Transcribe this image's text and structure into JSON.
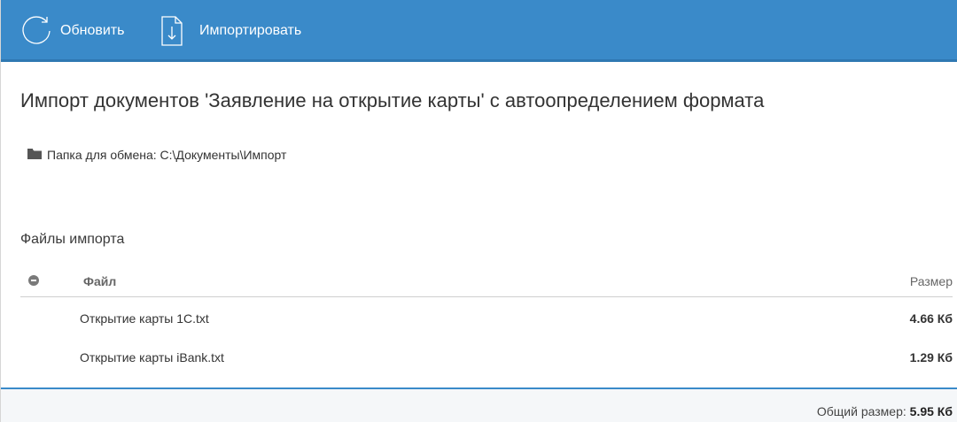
{
  "toolbar": {
    "refresh_label": "Обновить",
    "import_label": "Импортировать",
    "background": "#3a8ac9"
  },
  "page": {
    "title": "Импорт документов 'Заявление на открытие карты' с автоопределением формата",
    "folder_label": "Папка для обмена: C:\\Документы\\Импорт"
  },
  "files": {
    "section_title": "Файлы импорта",
    "columns": {
      "file": "Файл",
      "size": "Размер"
    },
    "rows": [
      {
        "name": "Открытие карты 1C.txt",
        "size": "4.66 Кб"
      },
      {
        "name": "Открытие карты iBank.txt",
        "size": "1.29 Кб"
      }
    ]
  },
  "footer": {
    "total_label": "Общий размер:",
    "total_value": "5.95 Кб"
  },
  "icons": {
    "refresh": "refresh-icon",
    "import": "import-document-icon",
    "folder": "folder-icon",
    "select_all": "toggle-all-icon"
  }
}
